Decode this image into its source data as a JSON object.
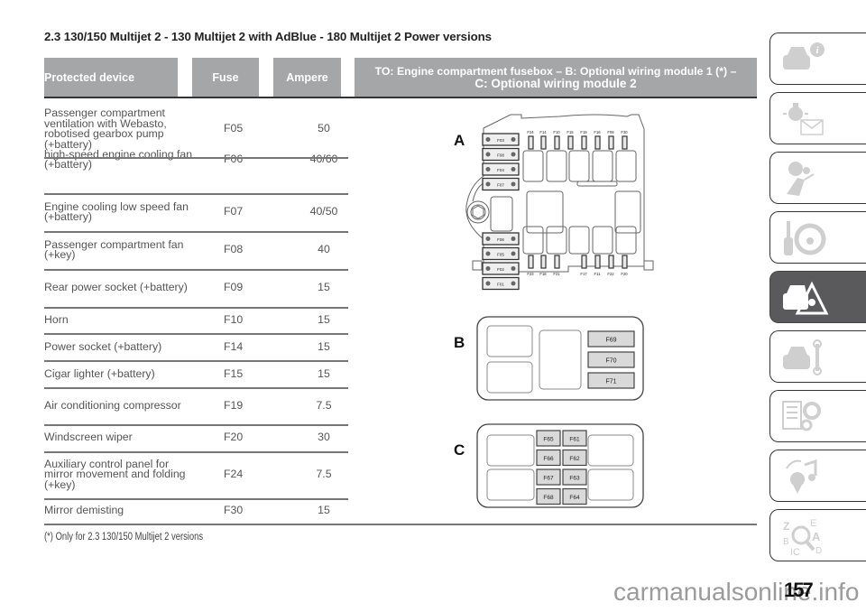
{
  "page": {
    "title": "2.3 130/150 Multijet 2 - 130 Multijet 2 with AdBlue - 180 Multijet 2 Power versions",
    "page_number": "157",
    "watermark": "carmanualsonline.info",
    "footnote": "(*) Only for 2.3 130/150 Multijet 2 versions"
  },
  "table": {
    "headers": {
      "device": "Protected device",
      "fuse": "Fuse",
      "ampere": "Ampere",
      "location_line1": "TO: Engine compartment fusebox – B: Optional wiring module 1 (*) –",
      "location_line2": "C: Optional wiring module 2"
    },
    "rows": [
      {
        "device": "Passenger compartment ventilation with Webasto, robotised gearbox pump (+battery)",
        "fuse": "F05",
        "ampere": "50"
      },
      {
        "device": "high-speed engine cooling fan (+battery)",
        "fuse": "F06",
        "ampere": "40/60"
      },
      {
        "device": "Engine cooling low speed fan (+battery)",
        "fuse": "F07",
        "ampere": "40/50"
      },
      {
        "device": "Passenger compartment fan (+key)",
        "fuse": "F08",
        "ampere": "40"
      },
      {
        "device": "Rear power socket (+battery)",
        "fuse": "F09",
        "ampere": "15"
      },
      {
        "device": "Horn",
        "fuse": "F10",
        "ampere": "15"
      },
      {
        "device": "Power socket (+battery)",
        "fuse": "F14",
        "ampere": "15"
      },
      {
        "device": "Cigar lighter (+battery)",
        "fuse": "F15",
        "ampere": "15"
      },
      {
        "device": "Air conditioning compressor",
        "fuse": "F19",
        "ampere": "7.5"
      },
      {
        "device": "Windscreen wiper",
        "fuse": "F20",
        "ampere": "30"
      },
      {
        "device": "Auxiliary control panel for mirror movement and folding (+key)",
        "fuse": "F24",
        "ampere": "7.5"
      },
      {
        "device": "Mirror demisting",
        "fuse": "F30",
        "ampere": "15"
      }
    ]
  },
  "diagrams": {
    "A": {
      "label": "A",
      "maxi_fuses_top": [
        "F03",
        "F08",
        "F04",
        "F07"
      ],
      "maxi_fuses_bottom": [
        "F06",
        "F05",
        "F02",
        "F01"
      ],
      "mini_fuses_top": [
        "F24",
        "F14",
        "F10",
        "F15",
        "F19",
        "F16",
        "F09",
        "F30"
      ],
      "mini_fuses_bottom": [
        "F23",
        "F18",
        "F21",
        "F17",
        "F11",
        "F22",
        "F20"
      ]
    },
    "B": {
      "label": "B",
      "fuses": [
        "F69",
        "F70",
        "F71"
      ]
    },
    "C": {
      "label": "C",
      "fuses_left": [
        "F65",
        "F66",
        "F67",
        "F68"
      ],
      "fuses_right": [
        "F61",
        "F62",
        "F63",
        "F64"
      ]
    }
  },
  "sidebar": {
    "tabs": [
      {
        "icon": "car-info-icon",
        "active": false
      },
      {
        "icon": "warning-light-message-icon",
        "active": false
      },
      {
        "icon": "airbag-seat-icon",
        "active": false
      },
      {
        "icon": "key-steering-wheel-icon",
        "active": false
      },
      {
        "icon": "emergency-warning-triangle-icon",
        "active": true
      },
      {
        "icon": "car-maintenance-wrench-icon",
        "active": false
      },
      {
        "icon": "technical-data-gears-icon",
        "active": false
      },
      {
        "icon": "multimedia-music-icon",
        "active": false
      },
      {
        "icon": "alphabetical-index-search-icon",
        "active": false
      }
    ]
  },
  "colors": {
    "header_bg": "#a5a6a8",
    "active_tab_bg": "#5a5a5c",
    "fuse_fill": "#d9d9d9"
  }
}
